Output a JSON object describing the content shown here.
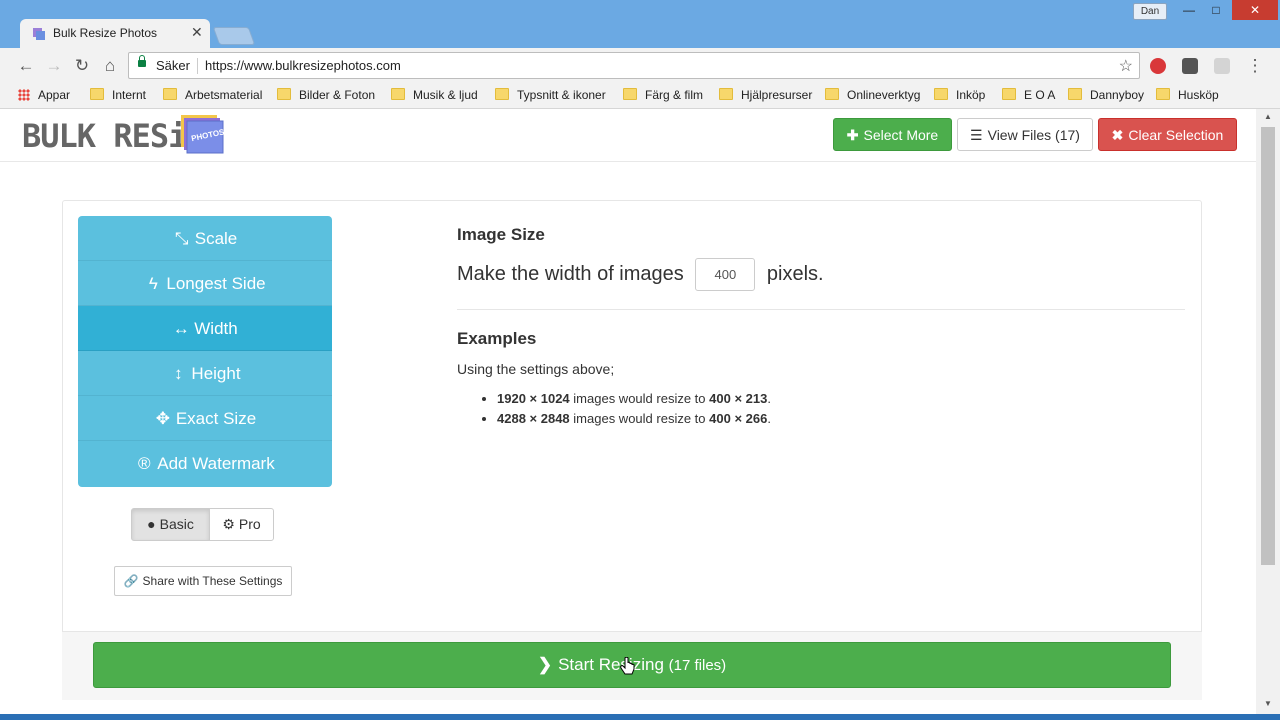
{
  "window": {
    "user": "Dan",
    "minimize": "—",
    "maximize": "□",
    "close": "✕"
  },
  "tab": {
    "title": "Bulk Resize Photos",
    "close": "✕"
  },
  "address": {
    "secure_label": "Säker",
    "url": "https://www.bulkresizephotos.com"
  },
  "bookmarks": [
    {
      "label": "Appar"
    },
    {
      "label": "Internt"
    },
    {
      "label": "Arbetsmaterial"
    },
    {
      "label": "Bilder & Foton"
    },
    {
      "label": "Musik & ljud"
    },
    {
      "label": "Typsnitt & ikoner"
    },
    {
      "label": "Färg & film"
    },
    {
      "label": "Hjälpresurser"
    },
    {
      "label": "Onlineverktyg"
    },
    {
      "label": "Inköp"
    },
    {
      "label": "E O A"
    },
    {
      "label": "Dannyboy"
    },
    {
      "label": "Husköp"
    }
  ],
  "header": {
    "logo_text": "BULK RESize",
    "logo_photo_text": "PHOTOS",
    "select_more": "Select More",
    "view_files": "View Files (17)",
    "clear_selection": "Clear Selection"
  },
  "menu": [
    {
      "label": "Scale",
      "icon": "compress-icon"
    },
    {
      "label": "Longest Side",
      "icon": "bolt-icon"
    },
    {
      "label": "Width",
      "icon": "arrows-horizontal-icon",
      "active": true
    },
    {
      "label": "Height",
      "icon": "arrows-vertical-icon"
    },
    {
      "label": "Exact Size",
      "icon": "move-icon"
    },
    {
      "label": "Add Watermark",
      "icon": "registered-icon"
    }
  ],
  "mode": {
    "basic": "Basic",
    "pro": "Pro",
    "selected": "Basic"
  },
  "share": "Share with These Settings",
  "settings": {
    "heading": "Image Size",
    "line_prefix": "Make the width of images",
    "width_value": "400",
    "line_suffix": "pixels."
  },
  "examples": {
    "heading": "Examples",
    "intro": "Using the settings above;",
    "items": [
      {
        "from": "1920 × 1024",
        "middle": "images would resize to",
        "to": "400 × 213",
        "end": "."
      },
      {
        "from": "4288 × 2848",
        "middle": "images would resize to",
        "to": "400 × 266",
        "end": "."
      }
    ]
  },
  "start": {
    "label": "Start Resizing",
    "count": "(17 files)"
  },
  "colors": {
    "menu": "#5bc0de",
    "menu_active": "#31b0d5",
    "green": "#4cae4c",
    "red": "#d9534f"
  }
}
